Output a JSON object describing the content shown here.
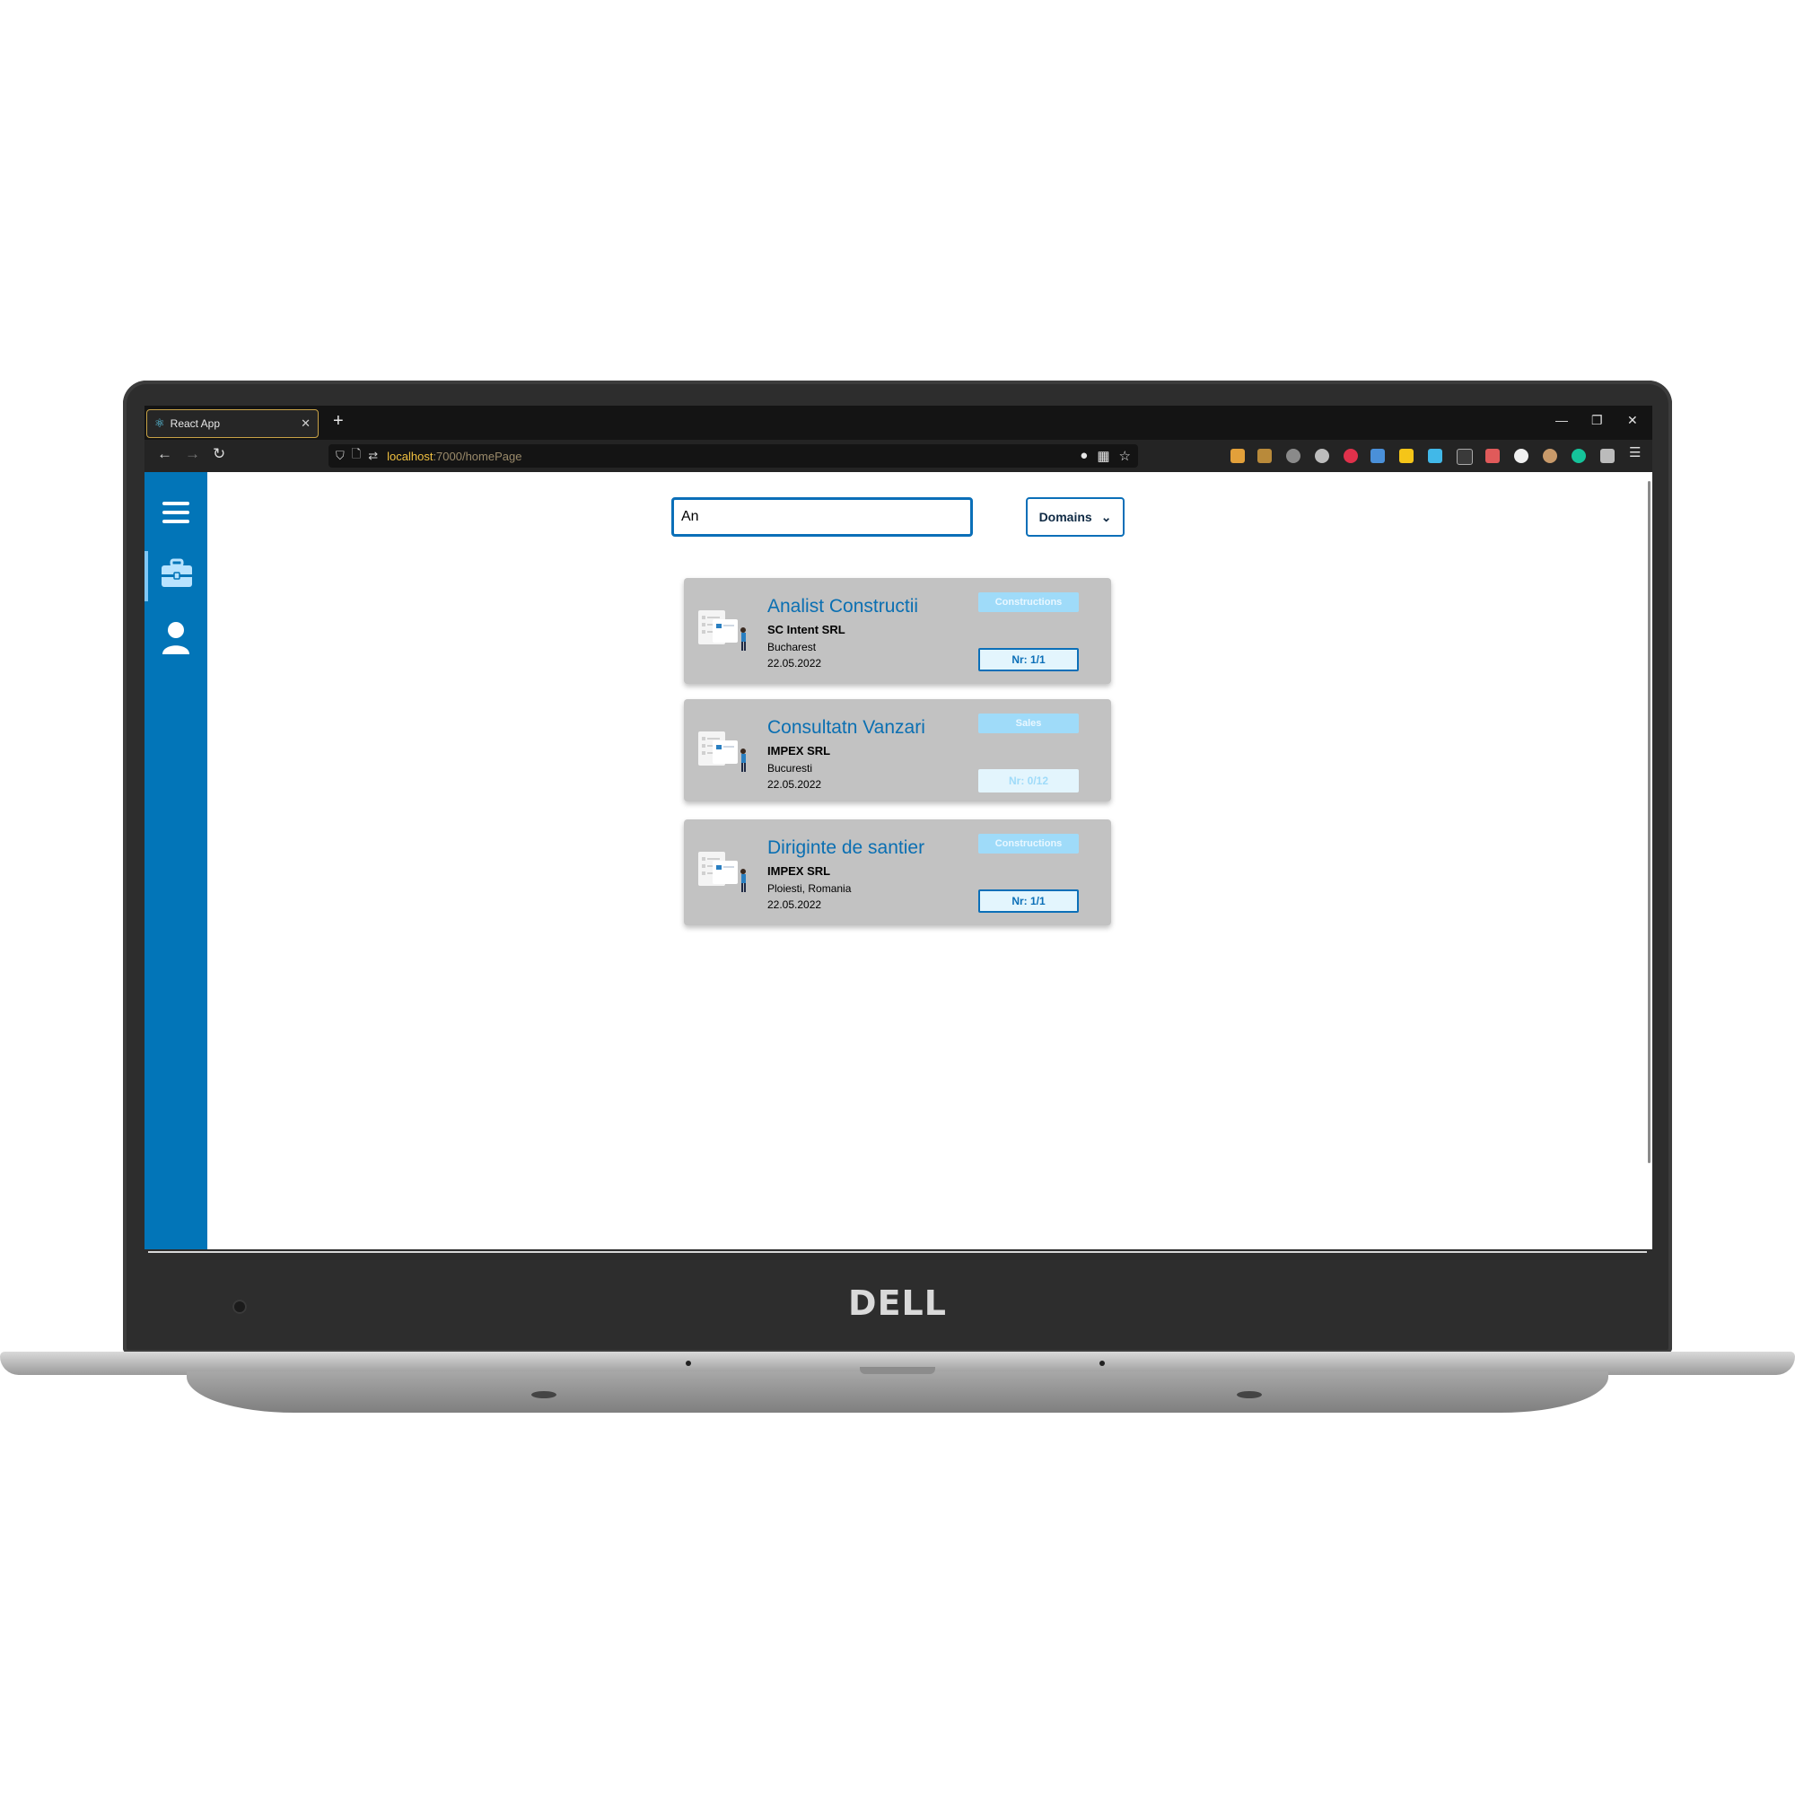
{
  "browser": {
    "tab_title": "React App",
    "new_tab": "+",
    "url_host": "localhost",
    "url_path": ":7000/homePage",
    "window_controls": [
      "—",
      "❐",
      "✕"
    ]
  },
  "device": {
    "brand": "DELL"
  },
  "sidebar": {
    "items": [
      {
        "icon": "hamburger-menu-icon"
      },
      {
        "icon": "briefcase-icon",
        "active": true
      },
      {
        "icon": "user-icon"
      }
    ],
    "color": "#0275b8"
  },
  "search": {
    "value": "An",
    "placeholder": ""
  },
  "filter": {
    "label": "Domains",
    "caret": "⌄"
  },
  "jobs": [
    {
      "title": "Analist Constructii",
      "company": "SC Intent SRL",
      "city": "Bucharest",
      "date": "22.05.2022",
      "domain": "Constructions",
      "count": "Nr: 1/1",
      "full": false
    },
    {
      "title": "Consultatn Vanzari",
      "company": "IMPEX SRL",
      "city": "Bucuresti",
      "date": "22.05.2022",
      "domain": "Sales",
      "count": "Nr: 0/12",
      "full": true
    },
    {
      "title": "Diriginte de santier",
      "company": "IMPEX SRL",
      "city": "Ploiesti, Romania",
      "date": "22.05.2022",
      "domain": "Constructions",
      "count": "Nr: 1/1",
      "full": false
    }
  ]
}
